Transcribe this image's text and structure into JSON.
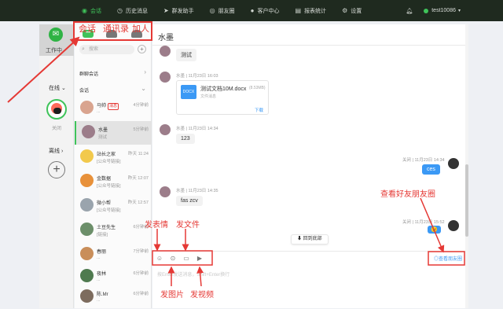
{
  "topbar": {
    "nav": [
      {
        "label": "会话",
        "icon": "chat-icon",
        "active": true
      },
      {
        "label": "历史消息",
        "icon": "clock-icon",
        "active": false
      },
      {
        "label": "群发助手",
        "icon": "send-icon",
        "active": false
      },
      {
        "label": "朋友圈",
        "icon": "moments-icon",
        "active": false
      },
      {
        "label": "客户中心",
        "icon": "user-icon",
        "active": false
      },
      {
        "label": "报表统计",
        "icon": "chart-icon",
        "active": false
      },
      {
        "label": "设置",
        "icon": "gear-icon",
        "active": false
      }
    ],
    "username": "test10086",
    "accent": "#3fc35a",
    "bg": "#1f2a1f"
  },
  "leftbar": {
    "workspace_label": "工作中",
    "online_label": "在线",
    "avatar_caption": "关闭",
    "offline_label": "离线",
    "add_label": "+"
  },
  "sidebar": {
    "search_placeholder": "搜索",
    "group_header": "群聊会话",
    "conv_header": "会话",
    "contacts": [
      {
        "name": "马帅",
        "tag": "消息",
        "sub": "...",
        "time": "4分钟前"
      },
      {
        "name": "水墨",
        "sub": "测试",
        "time": "5分钟前",
        "selected": true
      },
      {
        "name": "站长之家",
        "sub": "[公众号链接]",
        "time": "昨天 11:24"
      },
      {
        "name": "金数据",
        "sub": "[公众号链接]",
        "time": "昨天 12:07"
      },
      {
        "name": "微小帮",
        "sub": "[公众号链接]",
        "time": "昨天 12:57"
      },
      {
        "name": "土豆先生",
        "sub": "[链接]",
        "time": "6分钟前"
      },
      {
        "name": "春丽",
        "sub": "...",
        "time": "7分钟前"
      },
      {
        "name": "夜林",
        "sub": "...",
        "time": "6分钟前"
      },
      {
        "name": "陈.Mr",
        "sub": "...",
        "time": "6分钟前"
      }
    ]
  },
  "chat": {
    "title": "水墨",
    "messages": [
      {
        "text": "测试"
      },
      {
        "meta": "水墨 | 11月23日 16:03",
        "file_name": "测试文档10M.docx",
        "file_size": "(8.53MB)",
        "file_sub": "文件消息",
        "file_ext": "DOCX",
        "download": "下载"
      },
      {
        "meta": "水墨 | 11月23日 14:34",
        "text": "123"
      },
      {
        "meta": "关闭 | 11月23日 14:34",
        "text": "ces",
        "self": true
      },
      {
        "meta": "水墨 | 11月23日 14:35",
        "text": "fas zcv"
      },
      {
        "meta": "关闭 | 11月23日 15:52",
        "text": "😉",
        "self": true
      }
    ],
    "scroll_to_bottom": "回到底部",
    "view_moments": "查看朋友圈",
    "input_placeholder": "按Enter发送消息，Shift+Enter换行",
    "toolbar_icons": [
      "emoji-icon",
      "image-icon",
      "file-icon",
      "video-icon"
    ]
  },
  "annotations": {
    "tab_session": "会话",
    "tab_contacts": "通讯录",
    "tab_add": "加人",
    "emoji": "发表情",
    "file": "发文件",
    "image": "发图片",
    "video": "发视频",
    "moments": "查看好友朋友圈",
    "color": "#e53935"
  }
}
